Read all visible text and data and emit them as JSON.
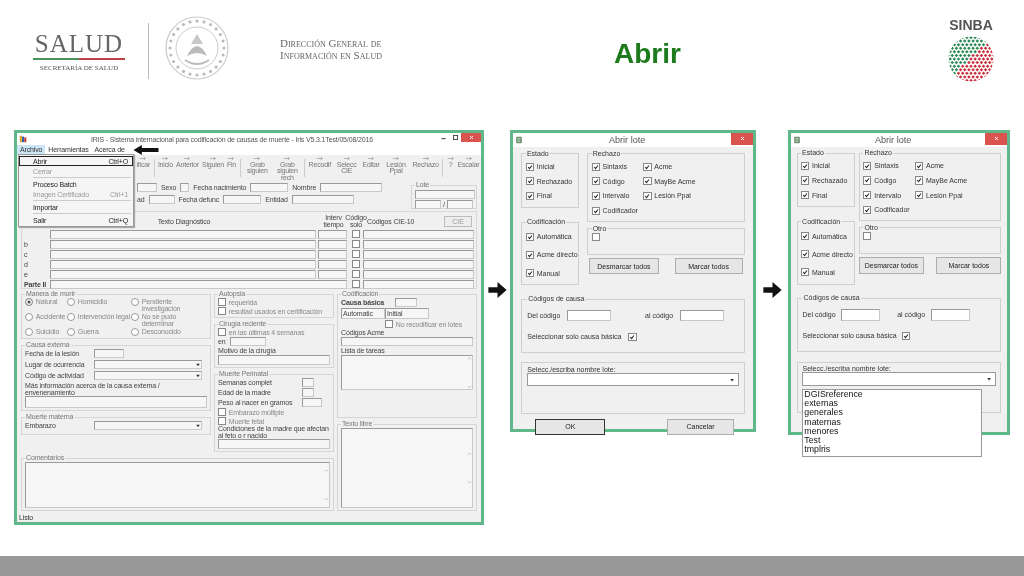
{
  "header": {
    "logo": {
      "name": "SALUD",
      "subtitle": "SECRETARÍA DE SALUD"
    },
    "agency": [
      "Dirección General de",
      "Información en Salud"
    ],
    "title": "Abrir",
    "brand": "SINBA"
  },
  "main_window": {
    "title": "IRIS - Sistema internacional para codificación de causas de muerte - Iris V5.3.1Test/05/08/2016",
    "menu": [
      {
        "label": "Archivo",
        "selected": true
      },
      {
        "label": "Herramientas",
        "selected": false
      },
      {
        "label": "Acerca de",
        "selected": false
      }
    ],
    "file_menu": [
      {
        "label": "Abrir",
        "shortcut": "Ctrl+O",
        "selected": true,
        "disabled": false,
        "separator_after": false
      },
      {
        "label": "Cerrar",
        "selected": false,
        "disabled": true,
        "separator_after": true
      },
      {
        "label": "Proceso Batch",
        "selected": false,
        "disabled": false,
        "separator_after": false
      },
      {
        "label": "Imagen Certificado",
        "shortcut": "Ctrl+1",
        "selected": false,
        "disabled": true,
        "separator_after": true
      },
      {
        "label": "Importar",
        "selected": false,
        "disabled": false,
        "separator_after": true
      },
      {
        "label": "Salir",
        "shortcut": "Ctrl+Q",
        "selected": false,
        "disabled": false,
        "separator_after": false
      }
    ],
    "toolbar_groups": [
      [
        "ificar"
      ],
      [
        "Inicio",
        "Anterior",
        "Siguien",
        "Fin"
      ],
      [
        "Grab siguien",
        "Grab siguien rech"
      ],
      [
        "Recodif",
        "Selecc CIE",
        "Editar",
        "Lesión Ppal",
        "Rechazo"
      ],
      [
        "?",
        "Escalar"
      ]
    ],
    "patient": {
      "row_1": [
        "Sexo",
        "Fecha nacimiento",
        "Nombre"
      ],
      "row_2": [
        "ad",
        "Fecha defunc",
        "Entidad"
      ],
      "lote": {
        "title": "Lote",
        "separator": "/"
      }
    },
    "diagnosis": {
      "columns": [
        "Texto Diagnóstico",
        "Interv tiempo",
        "Código solo",
        "Códigos CIE-10"
      ],
      "button": "CIE",
      "rows": [
        {
          "kind": "line",
          "checked": false
        },
        {
          "kind": "line",
          "label": "b",
          "checked": false
        },
        {
          "kind": "line",
          "label": "c",
          "checked": false
        },
        {
          "kind": "line",
          "label": "d",
          "checked": false
        },
        {
          "kind": "line",
          "label": "e",
          "checked": false
        },
        {
          "kind": "part",
          "label": "Parte II",
          "checked": false
        }
      ]
    },
    "manner_of_death": {
      "title": "Manera de morir",
      "options": [
        {
          "label": "Natural",
          "selected": true
        },
        {
          "label": "Homicidio",
          "selected": false
        },
        {
          "label": "Pendiente investigación",
          "selected": false
        },
        {
          "label": "Accidente",
          "selected": false
        },
        {
          "label": "Intervención legal",
          "selected": false
        },
        {
          "label": "No se pudo determinar",
          "selected": false
        },
        {
          "label": "Suicidio",
          "selected": false
        },
        {
          "label": "Guerra",
          "selected": false
        },
        {
          "label": "Desconocido",
          "selected": false
        }
      ]
    },
    "external_cause": {
      "title": "Causa externa",
      "date_label": "Fecha de la lesión",
      "place_label": "Lugar de ocurrencia",
      "activity_label": "Código de actividad",
      "more_label": "Más información acerca de la causa externa / envenenamiento"
    },
    "maternal": {
      "title": "Muerte materna",
      "pregnancy_label": "Embarazo"
    },
    "comments": {
      "title": "Comentarios"
    },
    "autopsy": {
      "title": "Autopsia",
      "options": [
        {
          "label": "requerida",
          "checked": false
        },
        {
          "label": "resultad usados en certificación",
          "checked": false
        }
      ]
    },
    "surgery": {
      "title": "Cirugía reciente",
      "option": {
        "label": "en las últimas 4 semanas",
        "checked": false
      },
      "date_label": "en",
      "reason_label": "Motivo de la cirugía"
    },
    "perinatal": {
      "title": "Muerte Perinatal",
      "weeks_label": "Semanas complet",
      "mother_age_label": "Edad de la madre",
      "weight_label": "Peso al nacer en gramos",
      "options": [
        {
          "label": "Embarazo múltiple",
          "checked": false
        },
        {
          "label": "Muerte fetal",
          "checked": false
        }
      ],
      "conditions_label": "Condiciones de la madre que afectan al feto o r nacido"
    },
    "coding": {
      "title": "Codificación",
      "basic_cause_label": "Causa básica",
      "mode_values": [
        "Automatic",
        "Initial"
      ],
      "no_recode": {
        "label": "No recodificar en lotes",
        "checked": false
      },
      "acme_label": "Códigos Acme",
      "tasks_label": "Lista de tareas"
    },
    "free_text": {
      "title": "Texto libre"
    },
    "status_bar": "Listo"
  },
  "dialogs": [
    {
      "title": "Abrir lote",
      "estado": {
        "title": "Estado",
        "options": [
          {
            "label": "Inicial",
            "checked": true
          },
          {
            "label": "Rechazado",
            "checked": true
          },
          {
            "label": "Final",
            "checked": true
          }
        ]
      },
      "rechazo": {
        "title": "Rechazo",
        "options": [
          {
            "label": "Sintaxis",
            "checked": true
          },
          {
            "label": "Acme",
            "checked": true
          },
          {
            "label": "Código",
            "checked": true
          },
          {
            "label": "MayBe Acme",
            "checked": true
          },
          {
            "label": "Intervalo",
            "checked": true
          },
          {
            "label": "Lesión Ppal",
            "checked": true
          },
          {
            "label": "Codificador",
            "checked": true
          }
        ]
      },
      "codificacion": {
        "title": "Codificación",
        "options": [
          {
            "label": "Automática",
            "checked": true
          },
          {
            "label": "Acme directo",
            "checked": true
          },
          {
            "label": "Manual",
            "checked": true
          }
        ]
      },
      "otro": {
        "title": "Otro",
        "checked": false
      },
      "buttons": [
        "Desmarcar todos",
        "Marcar todos"
      ],
      "codes": {
        "title": "Códigos de causa",
        "from_label": "Del código",
        "to_label": "al código",
        "basic_only": {
          "label": "Seleccionar solo causa básica",
          "checked": true
        }
      },
      "lote_label": "Selecc./escriba nombre lote:",
      "footer_buttons": [
        "OK",
        "Cancelar"
      ]
    },
    {
      "title": "Abrir lote",
      "estado": {
        "title": "Estado",
        "options": [
          {
            "label": "Inicial",
            "checked": true
          },
          {
            "label": "Rechazado",
            "checked": true
          },
          {
            "label": "Final",
            "checked": true
          }
        ]
      },
      "rechazo": {
        "title": "Rechazo",
        "options": [
          {
            "label": "Sintaxis",
            "checked": true
          },
          {
            "label": "Acme",
            "checked": true
          },
          {
            "label": "Código",
            "checked": true
          },
          {
            "label": "MayBe Acme",
            "checked": true
          },
          {
            "label": "Intervalo",
            "checked": true
          },
          {
            "label": "Lesión Ppal",
            "checked": true
          },
          {
            "label": "Codificador",
            "checked": true
          }
        ]
      },
      "codificacion": {
        "title": "Codificación",
        "options": [
          {
            "label": "Automática",
            "checked": true
          },
          {
            "label": "Acme directo",
            "checked": true
          },
          {
            "label": "Manual",
            "checked": true
          }
        ]
      },
      "otro": {
        "title": "Otro",
        "checked": false
      },
      "buttons": [
        "Desmarcar todos",
        "Marcar todos"
      ],
      "codes": {
        "title": "Códigos de causa",
        "from_label": "Del código",
        "to_label": "al código",
        "basic_only": {
          "label": "Seleccionar solo causa básica",
          "checked": true
        }
      },
      "lote_label": "Selecc./escriba nombre lote:",
      "open_list": [
        "DGISreference",
        "externas",
        "generales",
        "maternas",
        "menores",
        "Test",
        "tmplris"
      ]
    }
  ]
}
